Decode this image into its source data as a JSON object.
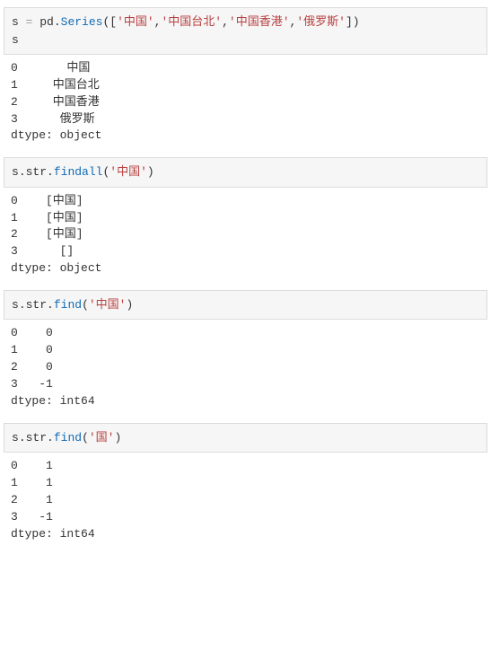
{
  "cells": [
    {
      "input_tokens": [
        {
          "t": "s ",
          "c": "tok-name"
        },
        {
          "t": "=",
          "c": "tok-op"
        },
        {
          "t": " pd",
          "c": "tok-name"
        },
        {
          "t": ".",
          "c": "tok-punct"
        },
        {
          "t": "Series",
          "c": "tok-func"
        },
        {
          "t": "([",
          "c": "tok-punct"
        },
        {
          "t": "'中国'",
          "c": "tok-str"
        },
        {
          "t": ",",
          "c": "tok-punct"
        },
        {
          "t": "'中国台北'",
          "c": "tok-str"
        },
        {
          "t": ",",
          "c": "tok-punct"
        },
        {
          "t": "'中国香港'",
          "c": "tok-str"
        },
        {
          "t": ",",
          "c": "tok-punct"
        },
        {
          "t": "'俄罗斯'",
          "c": "tok-str"
        },
        {
          "t": "])",
          "c": "tok-punct"
        },
        {
          "t": "\n",
          "c": ""
        },
        {
          "t": "s",
          "c": "tok-name"
        }
      ],
      "output": "0       中国\n1     中国台北\n2     中国香港\n3      俄罗斯\ndtype: object"
    },
    {
      "input_tokens": [
        {
          "t": "s",
          "c": "tok-name"
        },
        {
          "t": ".",
          "c": "tok-punct"
        },
        {
          "t": "str",
          "c": "tok-name"
        },
        {
          "t": ".",
          "c": "tok-punct"
        },
        {
          "t": "findall",
          "c": "tok-func"
        },
        {
          "t": "(",
          "c": "tok-punct"
        },
        {
          "t": "'中国'",
          "c": "tok-str"
        },
        {
          "t": ")",
          "c": "tok-punct"
        }
      ],
      "output": "0    [中国]\n1    [中国]\n2    [中国]\n3      []\ndtype: object"
    },
    {
      "input_tokens": [
        {
          "t": "s",
          "c": "tok-name"
        },
        {
          "t": ".",
          "c": "tok-punct"
        },
        {
          "t": "str",
          "c": "tok-name"
        },
        {
          "t": ".",
          "c": "tok-punct"
        },
        {
          "t": "find",
          "c": "tok-func"
        },
        {
          "t": "(",
          "c": "tok-punct"
        },
        {
          "t": "'中国'",
          "c": "tok-str"
        },
        {
          "t": ")",
          "c": "tok-punct"
        }
      ],
      "output": "0    0\n1    0\n2    0\n3   -1\ndtype: int64"
    },
    {
      "input_tokens": [
        {
          "t": "s",
          "c": "tok-name"
        },
        {
          "t": ".",
          "c": "tok-punct"
        },
        {
          "t": "str",
          "c": "tok-name"
        },
        {
          "t": ".",
          "c": "tok-punct"
        },
        {
          "t": "find",
          "c": "tok-func"
        },
        {
          "t": "(",
          "c": "tok-punct"
        },
        {
          "t": "'国'",
          "c": "tok-str"
        },
        {
          "t": ")",
          "c": "tok-punct"
        }
      ],
      "output": "0    1\n1    1\n2    1\n3   -1\ndtype: int64"
    }
  ]
}
